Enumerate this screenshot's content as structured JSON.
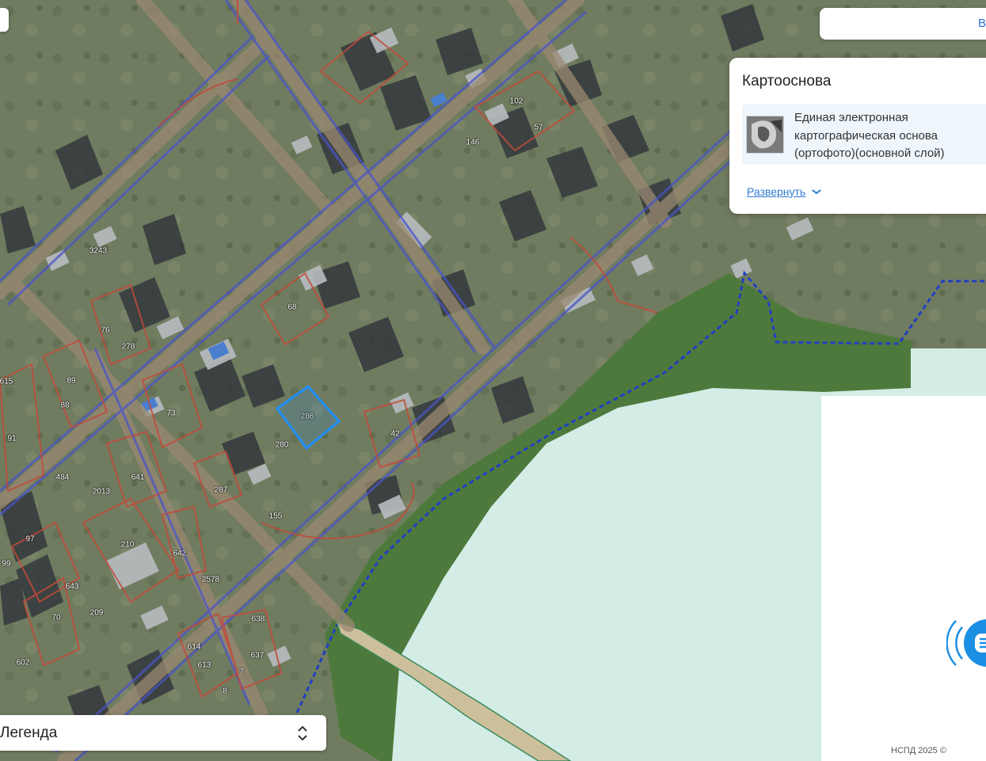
{
  "panel": {
    "title": "Картооснова",
    "layer_name": "Единая электронная картографическая основа (ортофото)(основной слой)",
    "expand_label": "Развернуть",
    "expand_icon": "chevron-down-icon"
  },
  "search": {
    "partial_text": "В"
  },
  "legend": {
    "label": "Легенда",
    "toggle_icon": "chevron-up-down-icon"
  },
  "chat": {
    "icon": "chat-bubble-icon",
    "color": "#1a8fe3"
  },
  "copyright": "НСПД 2025 ©",
  "colors": {
    "parcel_border": "#c24a3a",
    "road_boundary": "#4a55c8",
    "selected_parcel": "#1e90ff",
    "water": "#d3ece6",
    "zone_boundary": "#1f3fc4"
  },
  "parcels": [
    {
      "id": "102"
    },
    {
      "id": "57"
    },
    {
      "id": "146"
    },
    {
      "id": "3243"
    },
    {
      "id": "68"
    },
    {
      "id": "76"
    },
    {
      "id": "278"
    },
    {
      "id": "615"
    },
    {
      "id": "89"
    },
    {
      "id": "88"
    },
    {
      "id": "91"
    },
    {
      "id": "73"
    },
    {
      "id": "286",
      "selected": true
    },
    {
      "id": "280"
    },
    {
      "id": "42"
    },
    {
      "id": "484"
    },
    {
      "id": "641"
    },
    {
      "id": "2013"
    },
    {
      "id": "287"
    },
    {
      "id": "155"
    },
    {
      "id": "97"
    },
    {
      "id": "210"
    },
    {
      "id": "642"
    },
    {
      "id": "99"
    },
    {
      "id": "643"
    },
    {
      "id": "2578"
    },
    {
      "id": "70"
    },
    {
      "id": "209"
    },
    {
      "id": "638"
    },
    {
      "id": "614"
    },
    {
      "id": "637"
    },
    {
      "id": "613"
    },
    {
      "id": "602"
    },
    {
      "id": "7"
    },
    {
      "id": "8"
    }
  ]
}
